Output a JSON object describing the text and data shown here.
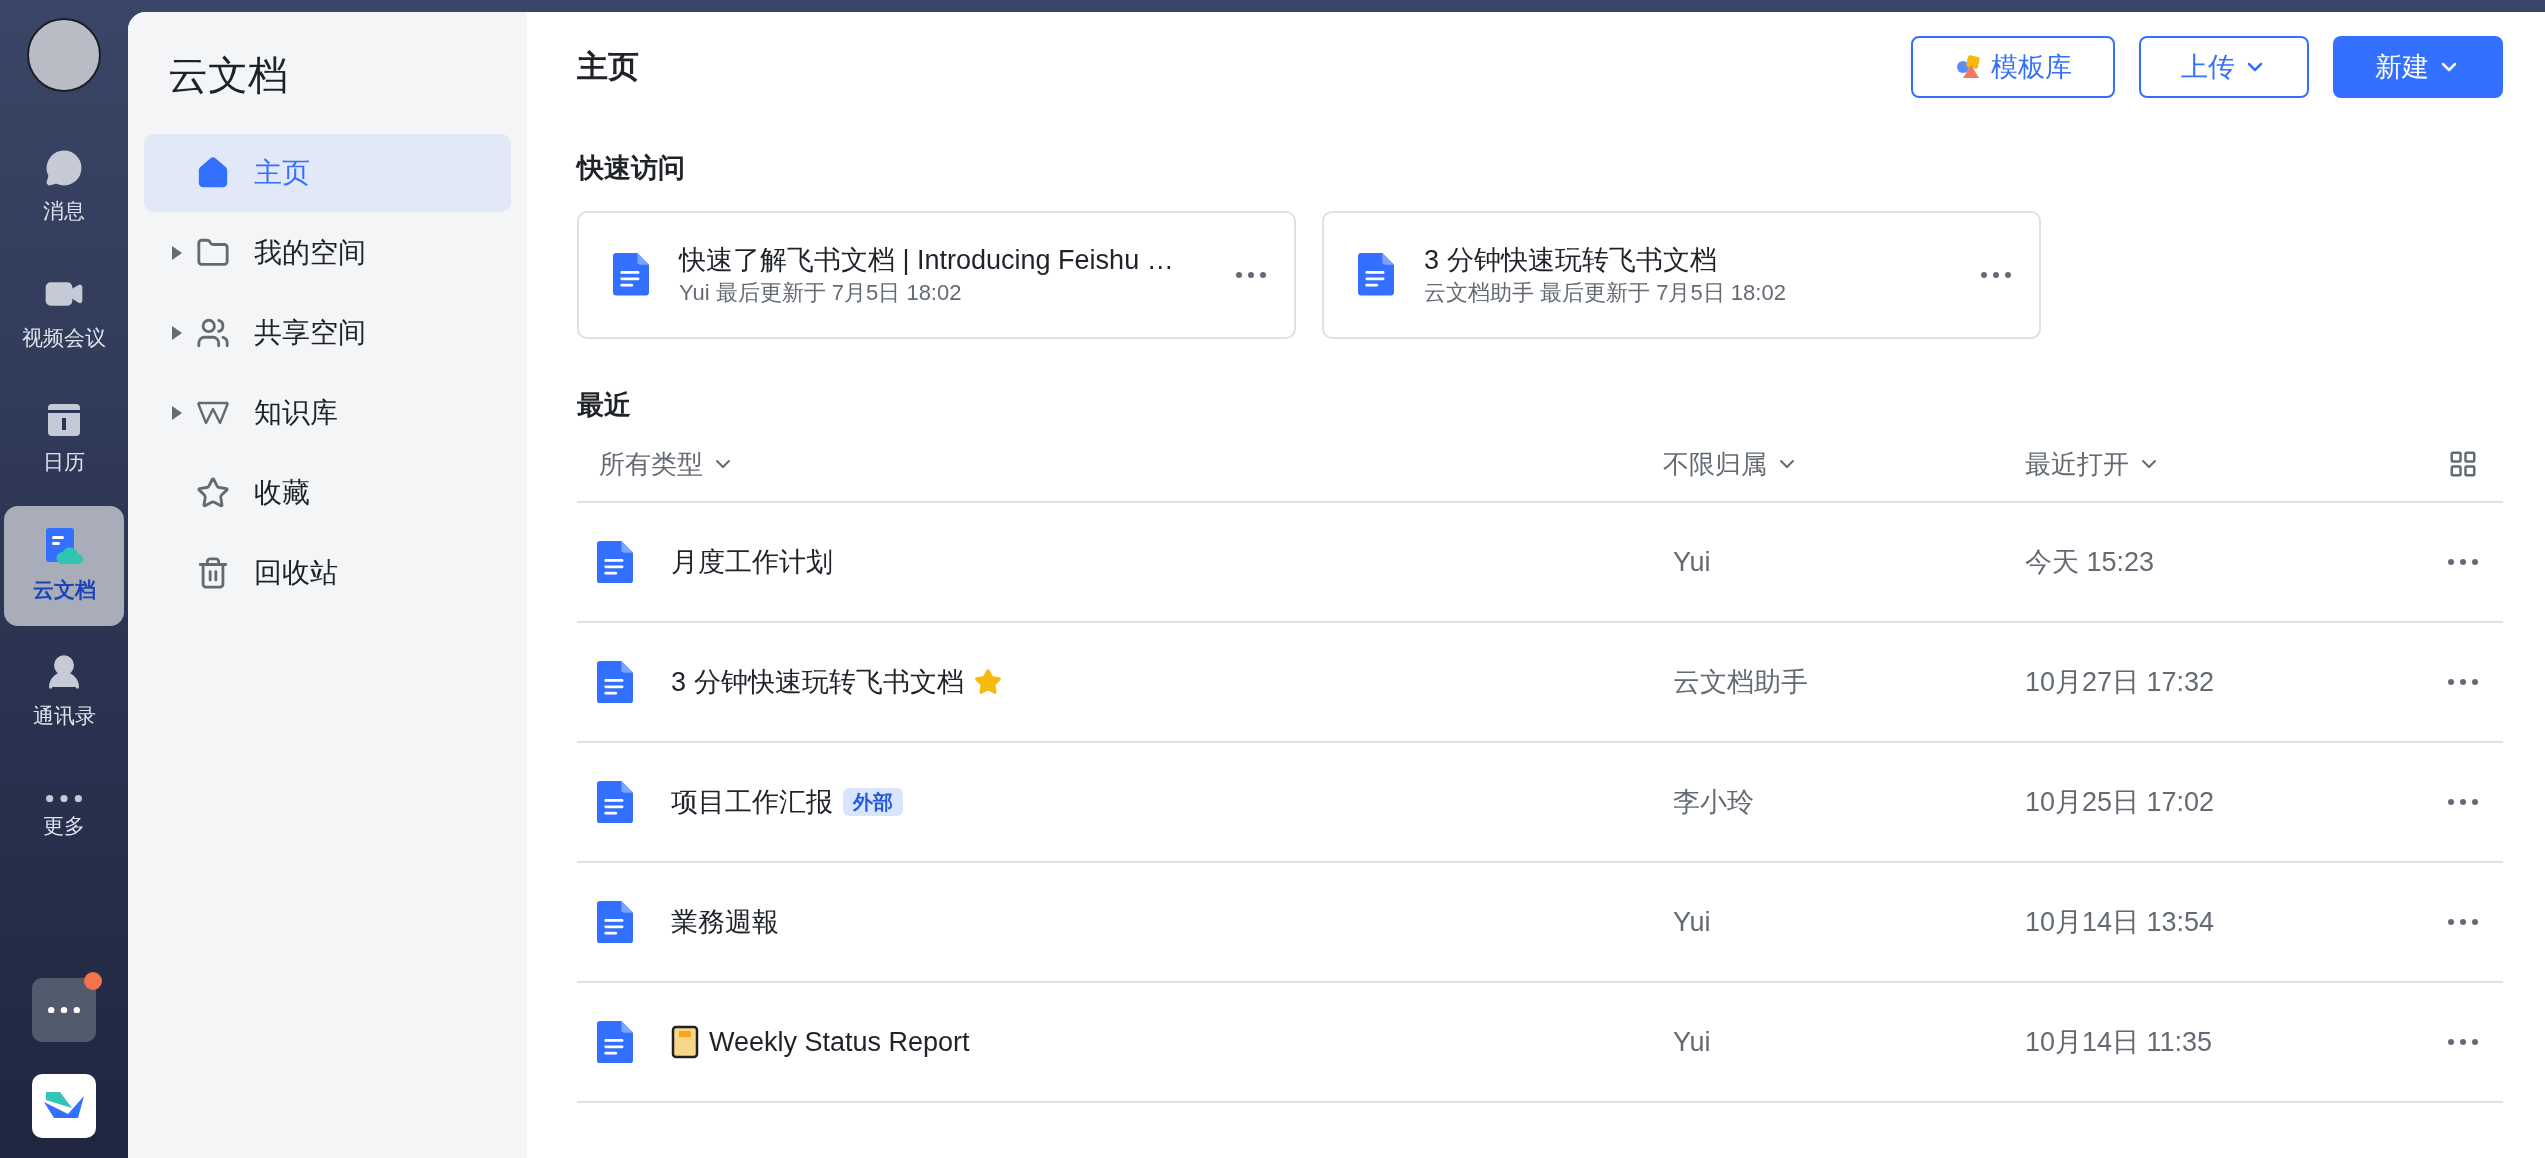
{
  "rail": {
    "items": [
      {
        "kind": "chat",
        "label": "消息",
        "selected": false
      },
      {
        "kind": "video",
        "label": "视频会议",
        "selected": false
      },
      {
        "kind": "calendar",
        "label": "日历",
        "selected": false
      },
      {
        "kind": "docs",
        "label": "云文档",
        "selected": true
      },
      {
        "kind": "contacts",
        "label": "通讯录",
        "selected": false
      },
      {
        "kind": "more",
        "label": "更多",
        "selected": false
      }
    ],
    "apps_badge": true
  },
  "sidebar": {
    "title": "云文档",
    "items": [
      {
        "kind": "home",
        "label": "主页",
        "expandable": false,
        "selected": true
      },
      {
        "kind": "folder",
        "label": "我的空间",
        "expandable": true,
        "selected": false
      },
      {
        "kind": "shared",
        "label": "共享空间",
        "expandable": true,
        "selected": false
      },
      {
        "kind": "wiki",
        "label": "知识库",
        "expandable": true,
        "selected": false
      },
      {
        "kind": "favorites",
        "label": "收藏",
        "expandable": false,
        "selected": false
      },
      {
        "kind": "trash",
        "label": "回收站",
        "expandable": false,
        "selected": false
      }
    ]
  },
  "header": {
    "title": "主页",
    "buttons": [
      {
        "kind": "template",
        "label": "模板库"
      },
      {
        "kind": "outline",
        "label": "上传"
      },
      {
        "kind": "primary",
        "label": "新建"
      }
    ]
  },
  "quick_access": {
    "title": "快速访问",
    "cards": [
      {
        "title": "快速了解飞书文档 | Introducing Feishu …",
        "meta": "Yui 最后更新于 7月5日 18:02"
      },
      {
        "title": "3 分钟快速玩转飞书文档",
        "meta": "云文档助手 最后更新于 7月5日 18:02"
      }
    ]
  },
  "recent": {
    "title": "最近",
    "filters": [
      {
        "label": "所有类型"
      },
      {
        "label": "不限归属"
      },
      {
        "label": "最近打开"
      }
    ],
    "rows": [
      {
        "kind": "doc",
        "name": "月度工作计划",
        "starred": false,
        "owner": "Yui",
        "time": "今天 15:23"
      },
      {
        "kind": "doc",
        "name": "3 分钟快速玩转飞书文档",
        "starred": true,
        "owner": "云文档助手",
        "time": "10月27日 17:32"
      },
      {
        "kind": "doc",
        "name": "项目工作汇报",
        "tag": "外部",
        "starred": false,
        "owner": "李小玲",
        "time": "10月25日 17:02"
      },
      {
        "kind": "doc",
        "name": "業務週報",
        "starred": false,
        "owner": "Yui",
        "time": "10月14日 13:54"
      },
      {
        "kind": "doc_with_emoji",
        "name": "Weekly Status Report",
        "starred": false,
        "owner": "Yui",
        "time": "10月14日 11:35"
      }
    ]
  }
}
